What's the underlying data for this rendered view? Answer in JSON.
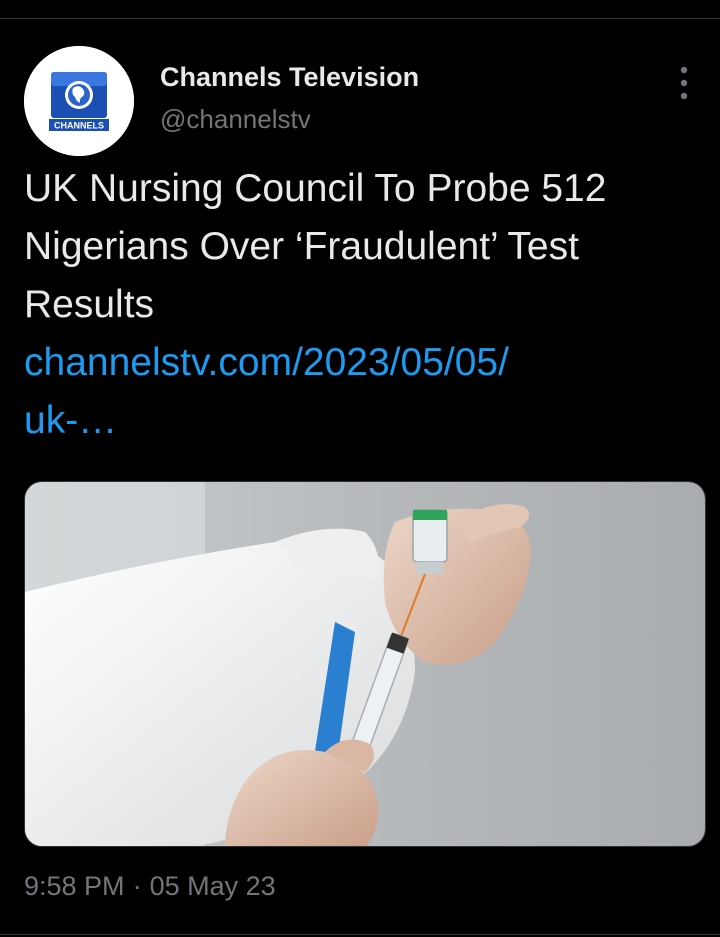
{
  "account": {
    "display_name": "Channels Television",
    "handle": "@channelstv",
    "avatar_icon": "channels-logo-icon",
    "logo_text": "CHANNELS"
  },
  "tweet": {
    "text_lines": [
      "UK Nursing Council To Probe 512",
      "Nigerians Over ‘Fraudulent’ Test",
      "Results"
    ],
    "link_lines": [
      "channelstv.com/2023/05/05/",
      "uk-…"
    ],
    "media_alt": "vaccine-syringe-photo"
  },
  "meta": {
    "time": "9:58 PM",
    "separator": "·",
    "date": "05 May 23"
  },
  "colors": {
    "background": "#000000",
    "text": "#e7e9ea",
    "secondary": "#71767b",
    "link": "#1d9bf0",
    "divider": "#2f3336"
  }
}
